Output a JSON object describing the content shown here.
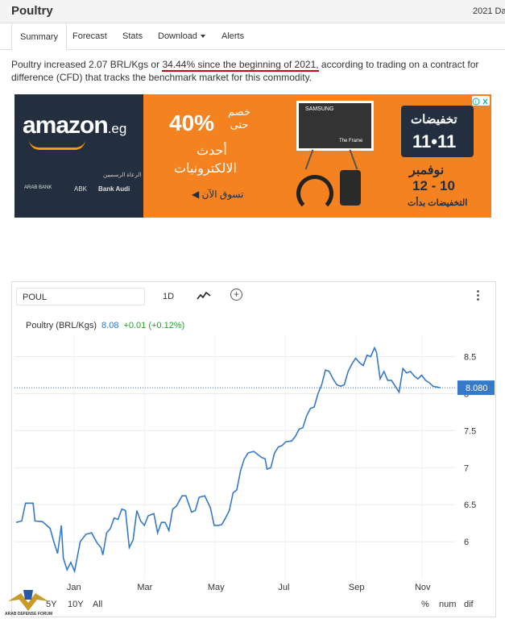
{
  "header": {
    "title": "Poultry",
    "date": "2021 Da"
  },
  "tabs": [
    "Summary",
    "Forecast",
    "Stats",
    "Download",
    "Alerts"
  ],
  "summary": {
    "before": "Poultry increased 2.07 BRL/Kgs or ",
    "highlight": "34.44% since the beginning of 2021,",
    "after": " according to trading on a contract for difference (CFD) that tracks the benchmark market for this commodity."
  },
  "ad": {
    "brand": "amazon",
    "brand_suffix": ".eg",
    "discount": "40%",
    "discount_text": "خصم حتى",
    "latest": "أحدث",
    "electronics": "الالكترونيات",
    "shop_now": "تسوق الآن",
    "frame_brand": "SAMSUNG",
    "frame_caption": "The Frame",
    "sale_title": "تخفيضات",
    "sale_date": "11•11",
    "november": "نوفمبر",
    "dates": "12 - 10",
    "sales_started": "التخفيضات بدأت",
    "sponsors": "الرعاة الرسميين",
    "partner_1": "Bank Audi",
    "partner_2": "ABK",
    "partner_3": "ARAB BANK"
  },
  "chart_toolbar": {
    "ticker": "POUL",
    "interval": "1D"
  },
  "legend": {
    "name": "Poultry (BRL/Kgs)",
    "value": "8.08",
    "change": "+0.01 (+0.12%)"
  },
  "range_buttons": [
    "5Y",
    "10Y",
    "All"
  ],
  "scale_buttons": [
    "%",
    "num",
    "dif"
  ],
  "watermark": "ARAB DEFENSE FORUM",
  "chart_data": {
    "type": "line",
    "xlabel": "",
    "ylabel": "",
    "x_ticks": [
      "Jan",
      "Mar",
      "May",
      "Jul",
      "Sep",
      "Nov"
    ],
    "y_ticks": [
      "6",
      "6.5",
      "7",
      "7.5",
      "8",
      "8.5"
    ],
    "ylim": [
      5.5,
      8.8
    ],
    "last_value_label": "8.080",
    "last_value": 8.08,
    "grid": true,
    "series": [
      {
        "color": "#3579c8",
        "points": [
          [
            0,
            6.26
          ],
          [
            3,
            6.28
          ],
          [
            5,
            6.52
          ],
          [
            9,
            6.52
          ],
          [
            10,
            6.28
          ],
          [
            14,
            6.27
          ],
          [
            18,
            6.18
          ],
          [
            20,
            6.0
          ],
          [
            22,
            5.84
          ],
          [
            24,
            6.22
          ],
          [
            25,
            5.78
          ],
          [
            27,
            5.62
          ],
          [
            29,
            5.72
          ],
          [
            31,
            5.6
          ],
          [
            34,
            6.0
          ],
          [
            37,
            6.1
          ],
          [
            40,
            6.12
          ],
          [
            43,
            5.98
          ],
          [
            45,
            5.92
          ],
          [
            46,
            5.82
          ],
          [
            48,
            6.12
          ],
          [
            50,
            6.18
          ],
          [
            52,
            6.32
          ],
          [
            54,
            6.3
          ],
          [
            56,
            6.44
          ],
          [
            58,
            6.42
          ],
          [
            60,
            5.92
          ],
          [
            62,
            6.02
          ],
          [
            64,
            6.42
          ],
          [
            66,
            6.28
          ],
          [
            68,
            6.22
          ],
          [
            70,
            6.35
          ],
          [
            73,
            6.38
          ],
          [
            75,
            6.12
          ],
          [
            77,
            6.26
          ],
          [
            79,
            6.26
          ],
          [
            81,
            6.15
          ],
          [
            83,
            6.44
          ],
          [
            85,
            6.48
          ],
          [
            88,
            6.62
          ],
          [
            90,
            6.62
          ],
          [
            93,
            6.4
          ],
          [
            95,
            6.42
          ],
          [
            97,
            6.6
          ],
          [
            100,
            6.62
          ],
          [
            103,
            6.46
          ],
          [
            105,
            6.22
          ],
          [
            107,
            6.22
          ],
          [
            109,
            6.23
          ],
          [
            111,
            6.32
          ],
          [
            113,
            6.42
          ],
          [
            115,
            6.66
          ],
          [
            117,
            6.7
          ],
          [
            119,
            6.96
          ],
          [
            121,
            7.12
          ],
          [
            123,
            7.2
          ],
          [
            126,
            7.22
          ],
          [
            128,
            7.18
          ],
          [
            130,
            7.14
          ],
          [
            132,
            7.12
          ],
          [
            133,
            6.98
          ],
          [
            135,
            7.0
          ],
          [
            137,
            7.2
          ],
          [
            139,
            7.28
          ],
          [
            141,
            7.3
          ],
          [
            143,
            7.35
          ],
          [
            146,
            7.36
          ],
          [
            148,
            7.42
          ],
          [
            150,
            7.52
          ],
          [
            152,
            7.54
          ],
          [
            154,
            7.7
          ],
          [
            156,
            7.8
          ],
          [
            158,
            7.82
          ],
          [
            160,
            8.0
          ],
          [
            162,
            8.12
          ],
          [
            164,
            8.32
          ],
          [
            166,
            8.3
          ],
          [
            168,
            8.2
          ],
          [
            170,
            8.12
          ],
          [
            172,
            8.1
          ],
          [
            174,
            8.12
          ],
          [
            176,
            8.3
          ],
          [
            178,
            8.4
          ],
          [
            180,
            8.48
          ],
          [
            182,
            8.42
          ],
          [
            184,
            8.38
          ],
          [
            186,
            8.52
          ],
          [
            188,
            8.5
          ],
          [
            190,
            8.62
          ],
          [
            191,
            8.56
          ],
          [
            193,
            8.2
          ],
          [
            195,
            8.3
          ],
          [
            197,
            8.18
          ],
          [
            199,
            8.18
          ],
          [
            201,
            8.1
          ],
          [
            203,
            8.02
          ],
          [
            205,
            8.34
          ],
          [
            207,
            8.28
          ],
          [
            209,
            8.3
          ],
          [
            211,
            8.24
          ],
          [
            213,
            8.2
          ],
          [
            215,
            8.25
          ],
          [
            217,
            8.18
          ],
          [
            219,
            8.15
          ],
          [
            221,
            8.1
          ],
          [
            223,
            8.09
          ],
          [
            225,
            8.08
          ]
        ]
      }
    ]
  }
}
